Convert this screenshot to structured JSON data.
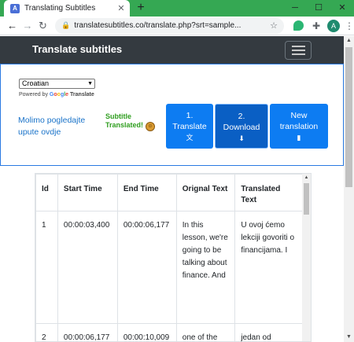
{
  "browser": {
    "tab_title": "Translating Subtitles",
    "tab_favicon_text": "A",
    "url": "translatesubtitles.co/translate.php?srt=sample...",
    "profile_initial": "A"
  },
  "navbar": {
    "brand": "Translate subtitles"
  },
  "panel": {
    "language_selected": "Croatian",
    "powered_by": "Powered by",
    "google_letters": [
      "G",
      "o",
      "o",
      "g",
      "l",
      "e"
    ],
    "translate_word": "Translate",
    "help_link": "Molimo pogledajte upute ovdje",
    "status": "Subtitle Translated!",
    "buttons": [
      {
        "label_line1": "1.",
        "label_line2": "Translate",
        "icon": "language-icon"
      },
      {
        "label_line1": "2.",
        "label_line2": "Download",
        "icon": "download-icon"
      },
      {
        "label_line1": "New",
        "label_line2": "translation",
        "icon": "file-icon"
      }
    ]
  },
  "table": {
    "headers": [
      "Id",
      "Start Time",
      "End Time",
      "Orignal Text",
      "Translated Text"
    ],
    "rows": [
      {
        "id": "1",
        "start": "00:00:03,400",
        "end": "00:00:06,177",
        "original": "In this lesson, we're going to be talking about finance. And",
        "translated": "U ovoj ćemo lekciji govoriti o financijama. I"
      },
      {
        "id": "2",
        "start": "00:00:06,177",
        "end": "00:00:10,009",
        "original": "one of the",
        "translated": "jedan od"
      }
    ]
  },
  "colors": {
    "navbar_bg": "#343a40",
    "button_blue": "#0d7cf2",
    "status_green": "#2f9e1f",
    "link_blue": "#1a73c9"
  }
}
